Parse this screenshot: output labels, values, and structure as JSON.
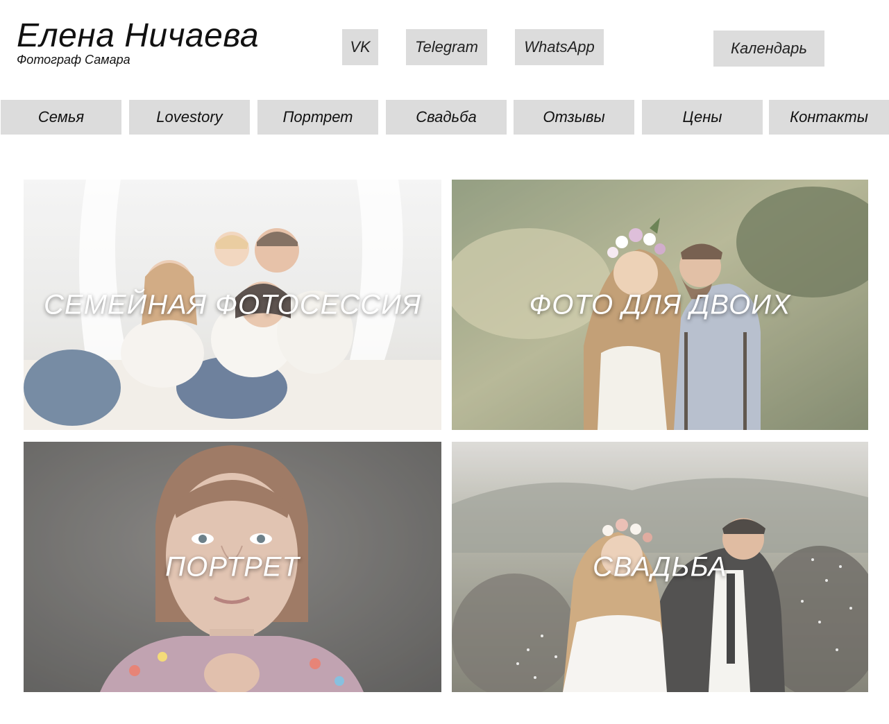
{
  "header": {
    "name": "Елена Ничаева",
    "subtitle": "Фотограф Самара"
  },
  "social": {
    "vk": "VK",
    "telegram": "Telegram",
    "whatsapp": "WhatsApp",
    "calendar": "Календарь"
  },
  "nav": [
    "Семья",
    "Lovestory",
    "Портрет",
    "Свадьба",
    "Отзывы",
    "Цены",
    "Контакты"
  ],
  "tiles": [
    {
      "label": "СЕМЕЙНАЯ ФОТОСЕССИЯ",
      "photo": "family-photo"
    },
    {
      "label": "ФОТО ДЛЯ ДВОИХ",
      "photo": "couple-photo"
    },
    {
      "label": "ПОРТРЕТ",
      "photo": "portrait-photo"
    },
    {
      "label": "СВАДЬБА",
      "photo": "wedding-photo"
    }
  ],
  "colors": {
    "button_bg": "#dcdcdc",
    "page_bg": "#ffffff",
    "tile_text": "#ffffff"
  }
}
